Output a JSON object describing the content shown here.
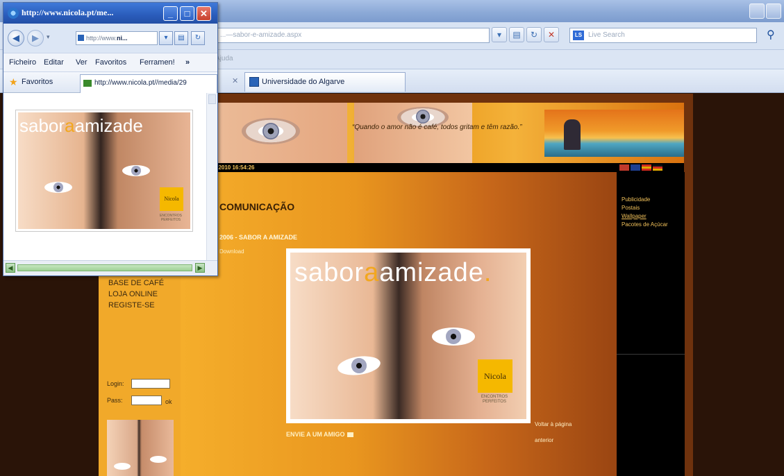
{
  "background_browser": {
    "address_url": "...—sabor-e-amizade.aspx",
    "search_placeholder": "Live Search",
    "menu_partial": "Ajuda",
    "tab_label": "Universidade do Algarve"
  },
  "site": {
    "header_quote": "“Quando o amor não é café, todos gritam e têm razão.”",
    "datebar_text": ", 2010 16:54:26",
    "left_menu": [
      "BASE DE CAFÉ",
      "LOJA ONLINE",
      "REGISTE-SE"
    ],
    "login_label": "Login:",
    "pass_label": "Pass:",
    "go_label": "ok",
    "section_title": "COMUNICAÇÃO",
    "subsection_title": "2006 - SABOR A AMIZADE",
    "download_label": "Download",
    "poster": {
      "text_before": "sabor",
      "text_accent": "a",
      "text_after": "amizade",
      "text_dot": ".",
      "brand": "Nicola",
      "brand_tagline": "ENCONTROS PERFEITOS"
    },
    "send_friend": "ENVIE A UM AMIGO",
    "back_link": "Voltar à página anterior",
    "right_links": [
      "Publicidade",
      "Postais",
      "Wallpaper",
      "Pacotes de Açúcar"
    ],
    "flag_colors": [
      "#c0392b",
      "#1f3f8f",
      "#e0a800",
      "#d12a1e"
    ]
  },
  "popup": {
    "title": "http://www.nicola.pt/me...",
    "address_prefix": "http://www.",
    "address_bold": "ni...",
    "menu": [
      "Ficheiro",
      "Editar",
      "Ver",
      "Favoritos",
      "Ferramen!",
      "»"
    ],
    "favorites_label": "Favoritos",
    "tab_url": "http://www.nicola.pt//media/29",
    "image": {
      "text_before": "sabor",
      "text_accent": "a",
      "text_after": "amizade",
      "brand": "Nicola",
      "brand_tagline": "ENCONTROS PERFEITOS"
    }
  }
}
